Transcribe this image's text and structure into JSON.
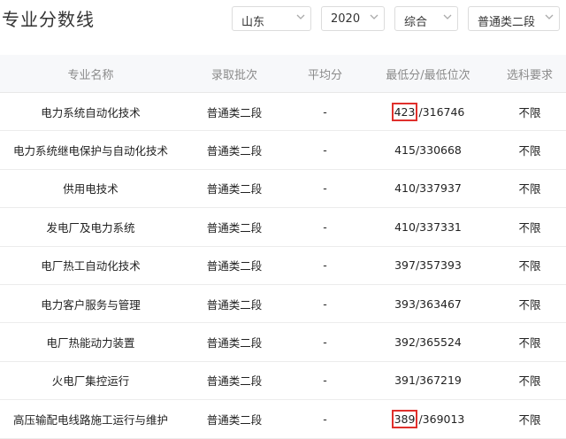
{
  "header": {
    "title": "专业分数线",
    "filters": {
      "province": "山东",
      "year": "2020",
      "subject_type": "综合",
      "batch": "普通类二段"
    }
  },
  "table": {
    "columns": [
      "专业名称",
      "录取批次",
      "平均分",
      "最低分/最低位次",
      "选科要求"
    ],
    "rows": [
      {
        "major": "电力系统自动化技术",
        "batch": "普通类二段",
        "avg": "-",
        "min_score": "423",
        "min_rank": "316746",
        "req": "不限",
        "highlight": true
      },
      {
        "major": "电力系统继电保护与自动化技术",
        "batch": "普通类二段",
        "avg": "-",
        "min_score": "415",
        "min_rank": "330668",
        "req": "不限",
        "highlight": false
      },
      {
        "major": "供用电技术",
        "batch": "普通类二段",
        "avg": "-",
        "min_score": "410",
        "min_rank": "337937",
        "req": "不限",
        "highlight": false
      },
      {
        "major": "发电厂及电力系统",
        "batch": "普通类二段",
        "avg": "-",
        "min_score": "410",
        "min_rank": "337331",
        "req": "不限",
        "highlight": false
      },
      {
        "major": "电厂热工自动化技术",
        "batch": "普通类二段",
        "avg": "-",
        "min_score": "397",
        "min_rank": "357393",
        "req": "不限",
        "highlight": false
      },
      {
        "major": "电力客户服务与管理",
        "batch": "普通类二段",
        "avg": "-",
        "min_score": "393",
        "min_rank": "363467",
        "req": "不限",
        "highlight": false
      },
      {
        "major": "电厂热能动力装置",
        "batch": "普通类二段",
        "avg": "-",
        "min_score": "392",
        "min_rank": "365524",
        "req": "不限",
        "highlight": false
      },
      {
        "major": "火电厂集控运行",
        "batch": "普通类二段",
        "avg": "-",
        "min_score": "391",
        "min_rank": "367219",
        "req": "不限",
        "highlight": false
      },
      {
        "major": "高压输配电线路施工运行与维护",
        "batch": "普通类二段",
        "avg": "-",
        "min_score": "389",
        "min_rank": "369013",
        "req": "不限",
        "highlight": true
      }
    ]
  },
  "colors": {
    "highlight_border": "#e0302c",
    "header_bg": "#f7f8fa"
  }
}
